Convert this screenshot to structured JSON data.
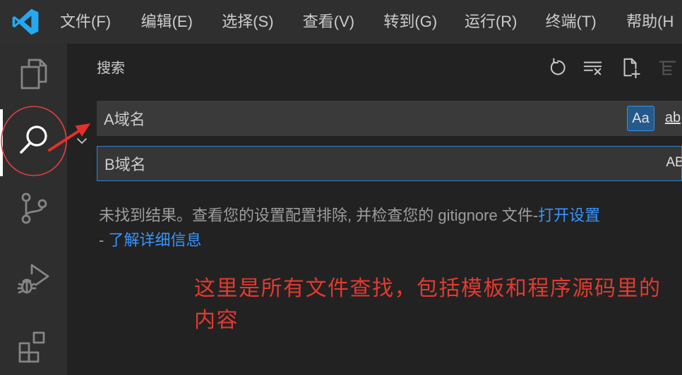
{
  "window": {
    "logo_icon": "vscode-logo-icon"
  },
  "menu": {
    "items": [
      {
        "label": "文件(F)"
      },
      {
        "label": "编辑(E)"
      },
      {
        "label": "选择(S)"
      },
      {
        "label": "查看(V)"
      },
      {
        "label": "转到(G)"
      },
      {
        "label": "运行(R)"
      },
      {
        "label": "终端(T)"
      },
      {
        "label": "帮助(H"
      }
    ]
  },
  "activity_bar": {
    "items": [
      {
        "icon": "explorer-files-icon",
        "active": false
      },
      {
        "icon": "search-icon",
        "active": true
      },
      {
        "icon": "source-control-icon",
        "active": false
      },
      {
        "icon": "run-debug-icon",
        "active": false
      },
      {
        "icon": "extensions-icon",
        "active": false
      }
    ]
  },
  "sidebar": {
    "title": "搜索",
    "actions": [
      {
        "icon": "refresh-icon"
      },
      {
        "icon": "clear-results-icon"
      },
      {
        "icon": "new-search-editor-icon"
      },
      {
        "icon": "collapse-all-icon",
        "disabled": true
      }
    ],
    "replace_toggle_icon": "chevron-down-icon",
    "search": {
      "value": "A域名",
      "match_case_label": "Aa",
      "match_case_active": true,
      "whole_word_label": "ab"
    },
    "replace": {
      "value": "B域名",
      "preserve_case_label": "AB"
    },
    "message": {
      "text": "未找到结果。查看您的设置配置排除, 并检查您的 gitignore 文件-",
      "open_settings_link": "打开设置",
      "line2_prefix": "- ",
      "learn_more_link": "了解详细信息"
    }
  },
  "annotation": {
    "line1": "这里是所有文件查找，包括模板和程序源码里的",
    "line2": "内容"
  },
  "colors": {
    "link": "#3794ff",
    "annotation_red": "#e23a2f",
    "focus_border": "#2f80d0",
    "toggle_active_bg": "#245a8a",
    "vscode_blue": "#23a9f2"
  }
}
